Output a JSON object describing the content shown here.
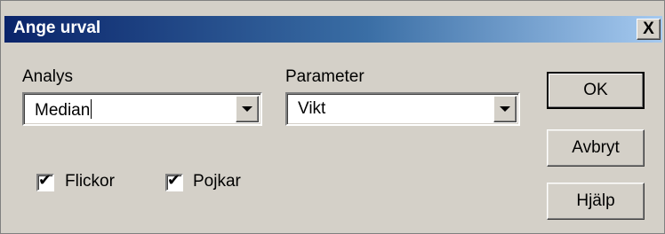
{
  "dialog": {
    "title": "Ange urval",
    "close_symbol": "X"
  },
  "analysis": {
    "label": "Analys",
    "value": "Median"
  },
  "parameter": {
    "label": "Parameter",
    "value": "Vikt"
  },
  "checkboxes": [
    {
      "label": "Flickor",
      "checked": true
    },
    {
      "label": "Pojkar",
      "checked": true
    }
  ],
  "buttons": {
    "ok": "OK",
    "cancel": "Avbryt",
    "help": "Hjälp"
  },
  "icons": {
    "close": "close-icon",
    "dropdown": "chevron-down-icon",
    "check": "checkmark-icon"
  }
}
